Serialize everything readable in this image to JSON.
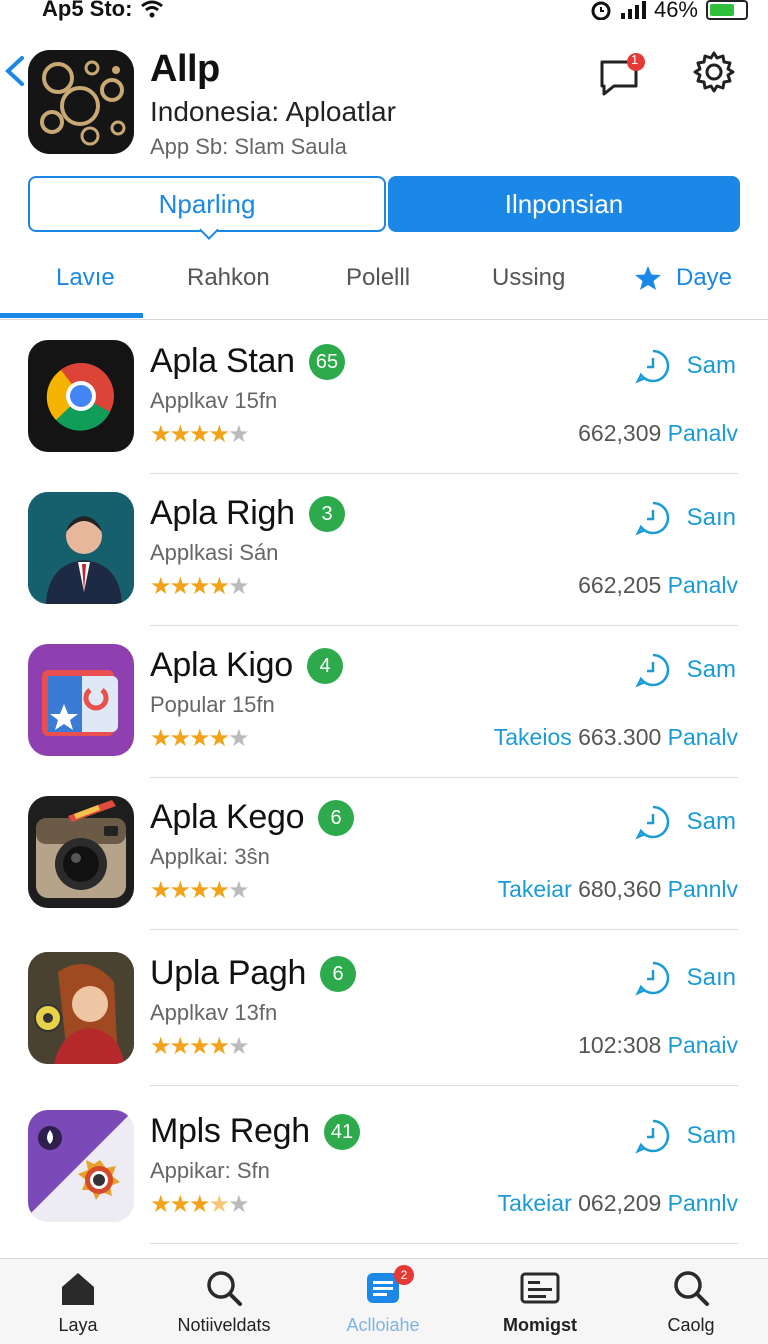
{
  "status_bar": {
    "carrier": "Ap5 Sto:",
    "battery": "46%"
  },
  "header": {
    "title": "Allp",
    "subtitle": "Indonesia: Aploatlar",
    "meta": "App Sb: Slam Saula",
    "message_badge": "1"
  },
  "segmented": {
    "left": "Nparling",
    "right": "Ilnponsian"
  },
  "tabs": [
    {
      "label": "Lavıe"
    },
    {
      "label": "Rahkon"
    },
    {
      "label": "Polelll"
    },
    {
      "label": "Ussing"
    },
    {
      "label": "Daye",
      "icon": "star-icon"
    }
  ],
  "colors": {
    "accent": "#1b87e6",
    "badge_green": "#2dab4c",
    "star": "#f2a31b",
    "link": "#1b9bd6"
  },
  "apps": [
    {
      "name": "Apla Stan",
      "badge": "65",
      "category": "Applkav 15fn",
      "rating": 4,
      "action": "Sam",
      "download_prefix": "",
      "downloads": "662,309",
      "download_suffix": "Panalv"
    },
    {
      "name": "Apla Righ",
      "badge": "3",
      "category": "Applkasi Sán",
      "rating": 4,
      "action": "Saın",
      "download_prefix": "",
      "downloads": "662,205",
      "download_suffix": "Panalv"
    },
    {
      "name": "Apla Kigo",
      "badge": "4",
      "category": "Popular 15fn",
      "rating": 4,
      "action": "Sam",
      "download_prefix": "Takeios",
      "downloads": "663.300",
      "download_suffix": "Panalv"
    },
    {
      "name": "Apla Kego",
      "badge": "6",
      "category": "Applkai: 3ŝn",
      "rating": 4,
      "action": "Sam",
      "download_prefix": "Takeiar",
      "downloads": "680,360",
      "download_suffix": "Pannlv"
    },
    {
      "name": "Upla Pagh",
      "badge": "6",
      "category": "Applkav 13fn",
      "rating": 4,
      "action": "Saın",
      "download_prefix": "",
      "downloads": "102:308",
      "download_suffix": "Panaiv"
    },
    {
      "name": "Mpls Regh",
      "badge": "41",
      "category": "Appikar: Sfn",
      "rating": 3,
      "action": "Sam",
      "download_prefix": "Takeiar",
      "downloads": "062,209",
      "download_suffix": "Pannlv"
    }
  ],
  "bottom_nav": [
    {
      "label": "Laya",
      "icon": "home-icon"
    },
    {
      "label": "Notiiveldats",
      "icon": "search-icon"
    },
    {
      "label": "Aclloiahe",
      "icon": "updates-icon",
      "badge": "2"
    },
    {
      "label": "Momigst",
      "icon": "news-icon"
    },
    {
      "label": "Caolg",
      "icon": "search-icon"
    }
  ]
}
